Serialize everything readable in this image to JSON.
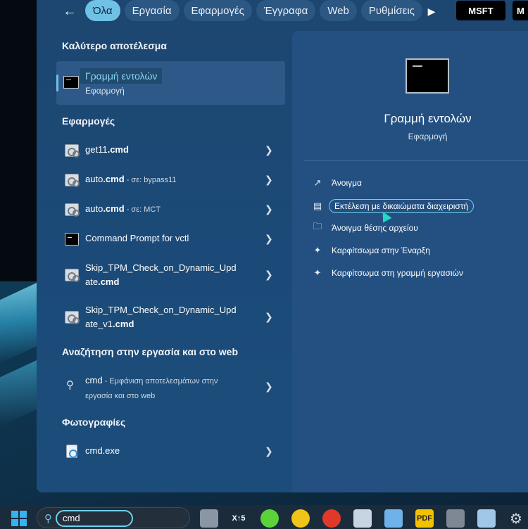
{
  "topbar": {
    "tabs": [
      {
        "label": "Όλα",
        "active": true
      },
      {
        "label": "Εργασία",
        "active": false
      },
      {
        "label": "Εφαρμογές",
        "active": false
      },
      {
        "label": "Έγγραφα",
        "active": false
      },
      {
        "label": "Web",
        "active": false
      },
      {
        "label": "Ρυθμίσεις",
        "active": false
      }
    ],
    "msft_label": "MSFT",
    "more_label": "M"
  },
  "left": {
    "best_heading": "Καλύτερο αποτέλεσμα",
    "best": {
      "title": "Γραμμή εντολών",
      "subtitle": "Εφαρμογή"
    },
    "apps_heading": "Εφαρμογές",
    "apps": [
      {
        "name": "get11",
        "ext": ".cmd",
        "meta": ""
      },
      {
        "name": "auto",
        "ext": ".cmd",
        "meta": " - σε: bypass11"
      },
      {
        "name": "auto",
        "ext": ".cmd",
        "meta": " - σε: MCT"
      },
      {
        "name": "Command Prompt for vctl",
        "ext": "",
        "meta": ""
      },
      {
        "name": "Skip_TPM_Check_on_Dynamic_Upd",
        "name2": "ate",
        "ext": ".cmd"
      },
      {
        "name": "Skip_TPM_Check_on_Dynamic_Upd",
        "name2": "ate_v1",
        "ext": ".cmd"
      }
    ],
    "web_heading": "Αναζήτηση στην εργασία και στο web",
    "web": {
      "query": "cmd",
      "line1": " - Εμφάνιση αποτελεσμάτων στην",
      "line2": "εργασία και στο web"
    },
    "photos_heading": "Φωτογραφίες",
    "photo": {
      "name": "cmd",
      "ext": ".exe"
    }
  },
  "right": {
    "title": "Γραμμή εντολών",
    "subtitle": "Εφαρμογή",
    "actions": [
      {
        "label": "Άνοιγμα",
        "icon": "open-external-icon"
      },
      {
        "label": "Εκτέλεση με δικαιώματα διαχειριστή",
        "icon": "shield-icon"
      },
      {
        "label": "Άνοιγμα θέσης αρχείου",
        "icon": "folder-icon"
      },
      {
        "label": "Καρφίτσωμα στην Έναρξη",
        "icon": "pin-icon"
      },
      {
        "label": "Καρφίτσωμα στη γραμμή εργασιών",
        "icon": "pin-icon"
      }
    ]
  },
  "taskbar": {
    "search_value": "cmd",
    "x5_label": "X↑5",
    "pdf_label": "PDF"
  },
  "colors": {
    "accent": "#6fc2e6",
    "panel": "#1d4670",
    "right_panel": "#235081"
  }
}
